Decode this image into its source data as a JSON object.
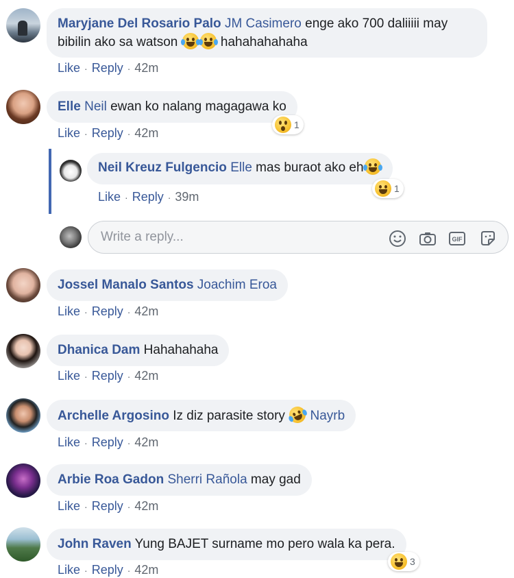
{
  "comments": [
    {
      "author": "Maryjane Del Rosario Palo",
      "mention": "JM Casimero",
      "text_line1": "enge ako 700 daliiiii may",
      "text_line2_pre": "bibilin ako sa watson",
      "text_line2_post": "hahahahahaha",
      "actions": {
        "like": "Like",
        "reply": "Reply",
        "time": "42m"
      }
    },
    {
      "author": "Elle",
      "mention": "Neil",
      "text": "ewan ko nalang magagawa ko",
      "reaction_count": "1",
      "actions": {
        "like": "Like",
        "reply": "Reply",
        "time": "42m"
      }
    },
    {
      "author": "Neil Kreuz Fulgencio",
      "mention": "Elle",
      "text": "mas buraot ako eh",
      "reaction_count": "1",
      "actions": {
        "like": "Like",
        "reply": "Reply",
        "time": "39m"
      }
    },
    {
      "author": "Jossel Manalo Santos",
      "mention": "Joachim Eroa",
      "actions": {
        "like": "Like",
        "reply": "Reply",
        "time": "42m"
      }
    },
    {
      "author": "Dhanica Dam",
      "text": "Hahahahaha",
      "actions": {
        "like": "Like",
        "reply": "Reply",
        "time": "42m"
      }
    },
    {
      "author": "Archelle Argosino",
      "text": "Iz diz parasite story",
      "mention": "Nayrb",
      "actions": {
        "like": "Like",
        "reply": "Reply",
        "time": "42m"
      }
    },
    {
      "author": "Arbie Roa Gadon",
      "mention": "Sherri Rañola",
      "text": "may gad",
      "actions": {
        "like": "Like",
        "reply": "Reply",
        "time": "42m"
      }
    },
    {
      "author": "John Raven",
      "text": "Yung BAJET surname mo pero wala ka pera.",
      "reaction_count": "3",
      "actions": {
        "like": "Like",
        "reply": "Reply",
        "time": "42m"
      }
    }
  ],
  "reply_box": {
    "placeholder": "Write a reply...",
    "icons": [
      "emoji-icon",
      "camera-icon",
      "gif-icon",
      "sticker-icon"
    ]
  },
  "colors": {
    "author": "#385898",
    "bubble": "#f0f2f5",
    "thread_line": "#4267b2",
    "meta": "#606770"
  }
}
